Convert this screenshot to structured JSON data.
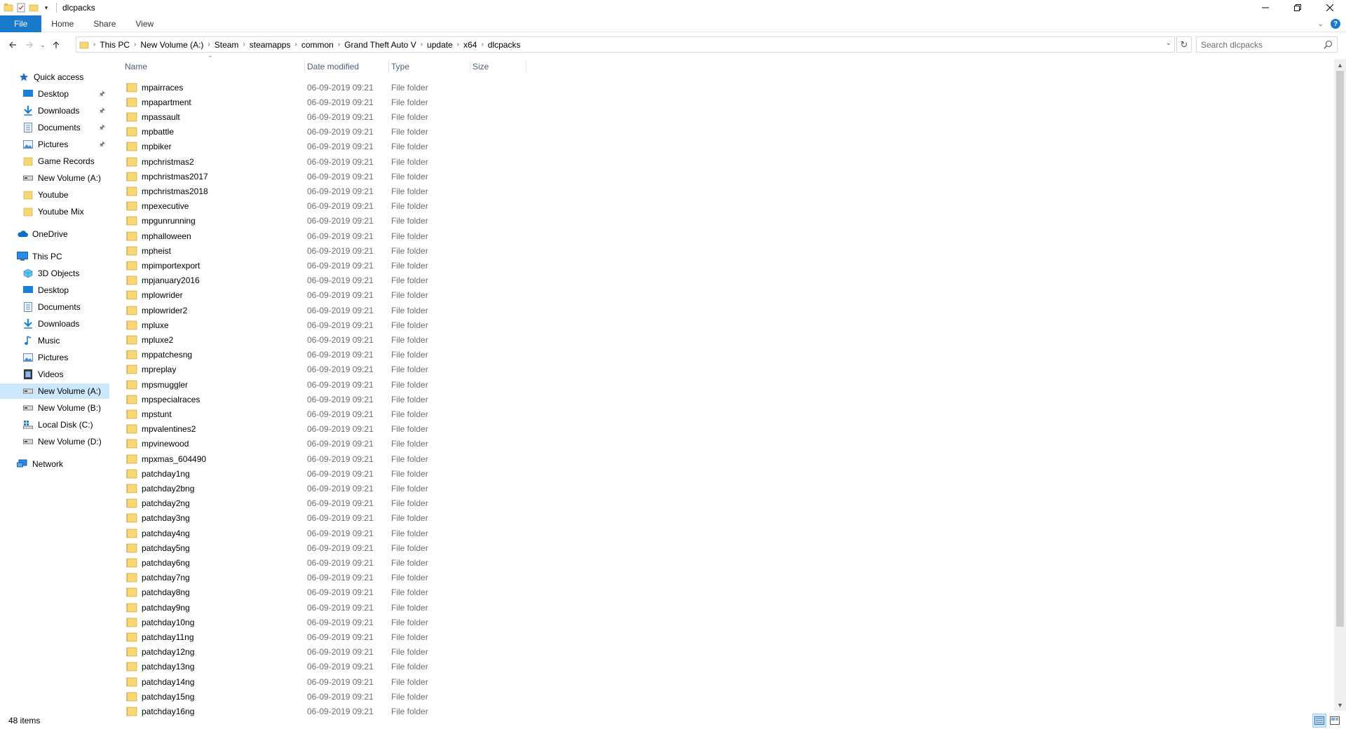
{
  "window": {
    "title": "dlcpacks",
    "controls": [
      "minimize-icon",
      "restore-icon",
      "close-icon"
    ]
  },
  "ribbon": {
    "tabs": [
      "File",
      "Home",
      "Share",
      "View"
    ]
  },
  "address": {
    "breadcrumbs": [
      "This PC",
      "New Volume (A:)",
      "Steam",
      "steamapps",
      "common",
      "Grand Theft Auto V",
      "update",
      "x64",
      "dlcpacks"
    ],
    "search_placeholder": "Search dlcpacks"
  },
  "sidebar": {
    "quick_access": {
      "label": "Quick access",
      "items": [
        {
          "label": "Desktop",
          "icon": "desktop-icon",
          "pinned": true
        },
        {
          "label": "Downloads",
          "icon": "downloads-icon",
          "pinned": true
        },
        {
          "label": "Documents",
          "icon": "documents-icon",
          "pinned": true
        },
        {
          "label": "Pictures",
          "icon": "pictures-icon",
          "pinned": true
        },
        {
          "label": "Game Records",
          "icon": "folder-icon",
          "pinned": false
        },
        {
          "label": "New Volume (A:)",
          "icon": "drive-icon",
          "pinned": false
        },
        {
          "label": "Youtube",
          "icon": "folder-icon",
          "pinned": false
        },
        {
          "label": "Youtube Mix",
          "icon": "folder-icon",
          "pinned": false
        }
      ]
    },
    "onedrive": {
      "label": "OneDrive"
    },
    "this_pc": {
      "label": "This PC",
      "items": [
        {
          "label": "3D Objects",
          "icon": "3d-objects-icon"
        },
        {
          "label": "Desktop",
          "icon": "desktop-icon"
        },
        {
          "label": "Documents",
          "icon": "documents-icon"
        },
        {
          "label": "Downloads",
          "icon": "downloads-icon"
        },
        {
          "label": "Music",
          "icon": "music-icon"
        },
        {
          "label": "Pictures",
          "icon": "pictures-icon"
        },
        {
          "label": "Videos",
          "icon": "videos-icon"
        },
        {
          "label": "New Volume (A:)",
          "icon": "drive-icon",
          "selected": true
        },
        {
          "label": "New Volume (B:)",
          "icon": "drive-icon"
        },
        {
          "label": "Local Disk (C:)",
          "icon": "windows-drive-icon"
        },
        {
          "label": "New Volume (D:)",
          "icon": "drive-icon"
        }
      ]
    },
    "network": {
      "label": "Network"
    }
  },
  "columns": {
    "name": "Name",
    "date_modified": "Date modified",
    "type": "Type",
    "size": "Size"
  },
  "files": [
    {
      "name": "mpairraces",
      "date": "06-09-2019 09:21",
      "type": "File folder"
    },
    {
      "name": "mpapartment",
      "date": "06-09-2019 09:21",
      "type": "File folder"
    },
    {
      "name": "mpassault",
      "date": "06-09-2019 09:21",
      "type": "File folder"
    },
    {
      "name": "mpbattle",
      "date": "06-09-2019 09:21",
      "type": "File folder"
    },
    {
      "name": "mpbiker",
      "date": "06-09-2019 09:21",
      "type": "File folder"
    },
    {
      "name": "mpchristmas2",
      "date": "06-09-2019 09:21",
      "type": "File folder"
    },
    {
      "name": "mpchristmas2017",
      "date": "06-09-2019 09:21",
      "type": "File folder"
    },
    {
      "name": "mpchristmas2018",
      "date": "06-09-2019 09:21",
      "type": "File folder"
    },
    {
      "name": "mpexecutive",
      "date": "06-09-2019 09:21",
      "type": "File folder"
    },
    {
      "name": "mpgunrunning",
      "date": "06-09-2019 09:21",
      "type": "File folder"
    },
    {
      "name": "mphalloween",
      "date": "06-09-2019 09:21",
      "type": "File folder"
    },
    {
      "name": "mpheist",
      "date": "06-09-2019 09:21",
      "type": "File folder"
    },
    {
      "name": "mpimportexport",
      "date": "06-09-2019 09:21",
      "type": "File folder"
    },
    {
      "name": "mpjanuary2016",
      "date": "06-09-2019 09:21",
      "type": "File folder"
    },
    {
      "name": "mplowrider",
      "date": "06-09-2019 09:21",
      "type": "File folder"
    },
    {
      "name": "mplowrider2",
      "date": "06-09-2019 09:21",
      "type": "File folder"
    },
    {
      "name": "mpluxe",
      "date": "06-09-2019 09:21",
      "type": "File folder"
    },
    {
      "name": "mpluxe2",
      "date": "06-09-2019 09:21",
      "type": "File folder"
    },
    {
      "name": "mppatchesng",
      "date": "06-09-2019 09:21",
      "type": "File folder"
    },
    {
      "name": "mpreplay",
      "date": "06-09-2019 09:21",
      "type": "File folder"
    },
    {
      "name": "mpsmuggler",
      "date": "06-09-2019 09:21",
      "type": "File folder"
    },
    {
      "name": "mpspecialraces",
      "date": "06-09-2019 09:21",
      "type": "File folder"
    },
    {
      "name": "mpstunt",
      "date": "06-09-2019 09:21",
      "type": "File folder"
    },
    {
      "name": "mpvalentines2",
      "date": "06-09-2019 09:21",
      "type": "File folder"
    },
    {
      "name": "mpvinewood",
      "date": "06-09-2019 09:21",
      "type": "File folder"
    },
    {
      "name": "mpxmas_604490",
      "date": "06-09-2019 09:21",
      "type": "File folder"
    },
    {
      "name": "patchday1ng",
      "date": "06-09-2019 09:21",
      "type": "File folder"
    },
    {
      "name": "patchday2bng",
      "date": "06-09-2019 09:21",
      "type": "File folder"
    },
    {
      "name": "patchday2ng",
      "date": "06-09-2019 09:21",
      "type": "File folder"
    },
    {
      "name": "patchday3ng",
      "date": "06-09-2019 09:21",
      "type": "File folder"
    },
    {
      "name": "patchday4ng",
      "date": "06-09-2019 09:21",
      "type": "File folder"
    },
    {
      "name": "patchday5ng",
      "date": "06-09-2019 09:21",
      "type": "File folder"
    },
    {
      "name": "patchday6ng",
      "date": "06-09-2019 09:21",
      "type": "File folder"
    },
    {
      "name": "patchday7ng",
      "date": "06-09-2019 09:21",
      "type": "File folder"
    },
    {
      "name": "patchday8ng",
      "date": "06-09-2019 09:21",
      "type": "File folder"
    },
    {
      "name": "patchday9ng",
      "date": "06-09-2019 09:21",
      "type": "File folder"
    },
    {
      "name": "patchday10ng",
      "date": "06-09-2019 09:21",
      "type": "File folder"
    },
    {
      "name": "patchday11ng",
      "date": "06-09-2019 09:21",
      "type": "File folder"
    },
    {
      "name": "patchday12ng",
      "date": "06-09-2019 09:21",
      "type": "File folder"
    },
    {
      "name": "patchday13ng",
      "date": "06-09-2019 09:21",
      "type": "File folder"
    },
    {
      "name": "patchday14ng",
      "date": "06-09-2019 09:21",
      "type": "File folder"
    },
    {
      "name": "patchday15ng",
      "date": "06-09-2019 09:21",
      "type": "File folder"
    },
    {
      "name": "patchday16ng",
      "date": "06-09-2019 09:21",
      "type": "File folder"
    }
  ],
  "status": {
    "item_count": "48 items"
  },
  "colors": {
    "accent": "#1979ca",
    "selection": "#cce8ff",
    "folder": "#f8d775",
    "header_text": "#4c607a"
  }
}
